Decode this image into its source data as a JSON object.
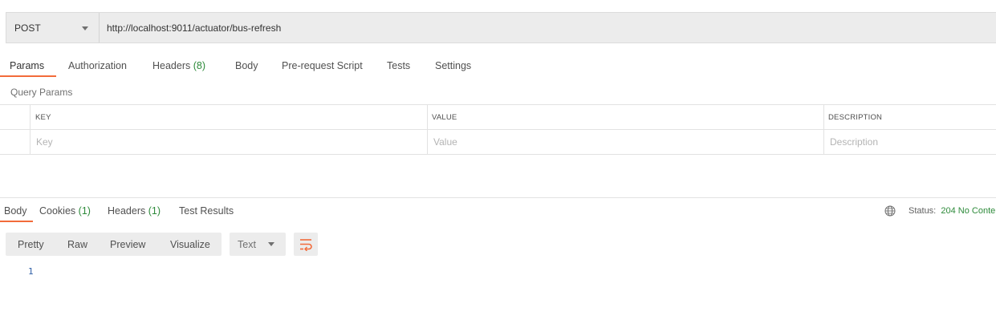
{
  "request": {
    "method": "POST",
    "url": "http://localhost:9011/actuator/bus-refresh"
  },
  "request_tabs": [
    {
      "label": "Params",
      "count": ""
    },
    {
      "label": "Authorization",
      "count": ""
    },
    {
      "label": "Headers",
      "count": "(8)"
    },
    {
      "label": "Body",
      "count": ""
    },
    {
      "label": "Pre-request Script",
      "count": ""
    },
    {
      "label": "Tests",
      "count": ""
    },
    {
      "label": "Settings",
      "count": ""
    }
  ],
  "params": {
    "title": "Query Params",
    "columns": [
      "KEY",
      "VALUE",
      "DESCRIPTION"
    ],
    "placeholders": [
      "Key",
      "Value",
      "Description"
    ]
  },
  "response_tabs": [
    {
      "label": "Body",
      "count": ""
    },
    {
      "label": "Cookies",
      "count": "(1)"
    },
    {
      "label": "Headers",
      "count": "(1)"
    },
    {
      "label": "Test Results",
      "count": ""
    }
  ],
  "status": {
    "label": "Status:",
    "value": "204 No Conte"
  },
  "response_view": {
    "modes": [
      "Pretty",
      "Raw",
      "Preview",
      "Visualize"
    ],
    "format": "Text",
    "line_numbers": [
      "1"
    ]
  },
  "colors": {
    "accent": "#f26b3a",
    "count_green": "#2d8a3a",
    "line_number_blue": "#2f5fa6"
  }
}
